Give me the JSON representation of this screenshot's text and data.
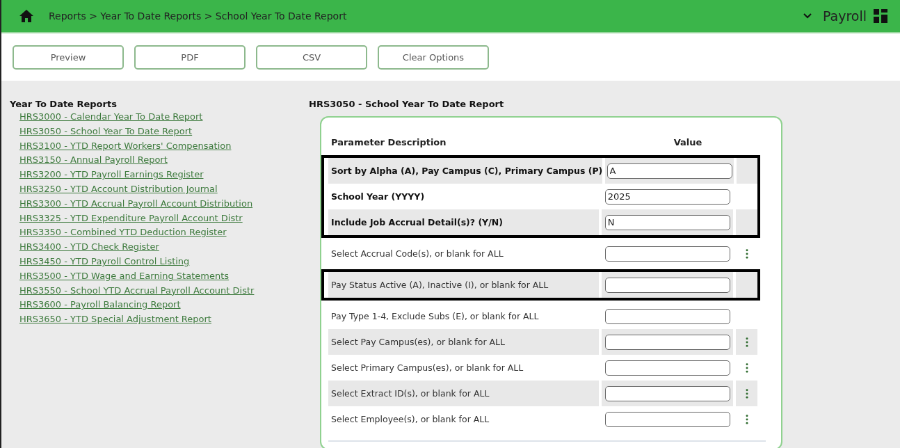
{
  "header": {
    "breadcrumb": "Reports > Year To Date Reports > School Year To Date Report",
    "module": "Payroll"
  },
  "toolbar": {
    "buttons": [
      "Preview",
      "PDF",
      "CSV",
      "Clear Options"
    ]
  },
  "sidebar": {
    "title": "Year To Date Reports",
    "items": [
      {
        "label": "HRS3000 - Calendar Year To Date Report"
      },
      {
        "label": "HRS3050 - School Year To Date Report"
      },
      {
        "label": "HRS3100 - YTD Report Workers' Compensation"
      },
      {
        "label": "HRS3150 - Annual Payroll Report"
      },
      {
        "label": "HRS3200 - YTD Payroll Earnings Register"
      },
      {
        "label": "HRS3250 - YTD Account Distribution Journal"
      },
      {
        "label": "HRS3300 - YTD Accrual Payroll Account Distribution"
      },
      {
        "label": "HRS3325 - YTD Expenditure Payroll Account Distr"
      },
      {
        "label": "HRS3350 - Combined YTD Deduction Register"
      },
      {
        "label": "HRS3400 - YTD Check Register"
      },
      {
        "label": "HRS3450 - YTD Payroll Control Listing"
      },
      {
        "label": "HRS3500 - YTD Wage and Earning Statements"
      },
      {
        "label": "HRS3550 - School YTD Accrual Payroll Account Distr"
      },
      {
        "label": "HRS3600 - Payroll Balancing Report"
      },
      {
        "label": "HRS3650 - YTD Special Adjustment Report"
      }
    ]
  },
  "report": {
    "title": "HRS3050 - School Year To Date Report",
    "columns": [
      "Parameter Description",
      "Value"
    ],
    "sections": [
      {
        "outlined": true,
        "rows": [
          {
            "label": "Sort by Alpha (A), Pay Campus (C), Primary Campus (P)",
            "bold": true,
            "value": "A",
            "lookup": false
          },
          {
            "label": "School Year (YYYY)",
            "bold": true,
            "value": "2025",
            "lookup": false
          },
          {
            "label": "Include Job Accrual Detail(s)? (Y/N)",
            "bold": true,
            "value": "N",
            "lookup": false
          }
        ]
      },
      {
        "outlined": false,
        "rows": [
          {
            "label": "Select Accrual Code(s), or blank for ALL",
            "bold": false,
            "lookup": true
          }
        ]
      },
      {
        "outlined": true,
        "rows": [
          {
            "label": "Pay Status Active (A), Inactive (I), or blank for ALL",
            "bold": false,
            "lookup": false
          }
        ]
      },
      {
        "outlined": false,
        "rows": [
          {
            "label": "Pay Type 1-4, Exclude Subs (E), or blank for ALL",
            "bold": false,
            "lookup": false
          },
          {
            "label": "Select Pay Campus(es), or blank for ALL",
            "bold": false,
            "lookup": true
          },
          {
            "label": "Select Primary Campus(es), or blank for ALL",
            "bold": false,
            "lookup": true
          },
          {
            "label": "Select Extract ID(s), or blank for ALL",
            "bold": false,
            "lookup": true
          },
          {
            "label": "Select Employee(s), or blank for ALL",
            "bold": false,
            "lookup": true
          }
        ]
      }
    ]
  }
}
